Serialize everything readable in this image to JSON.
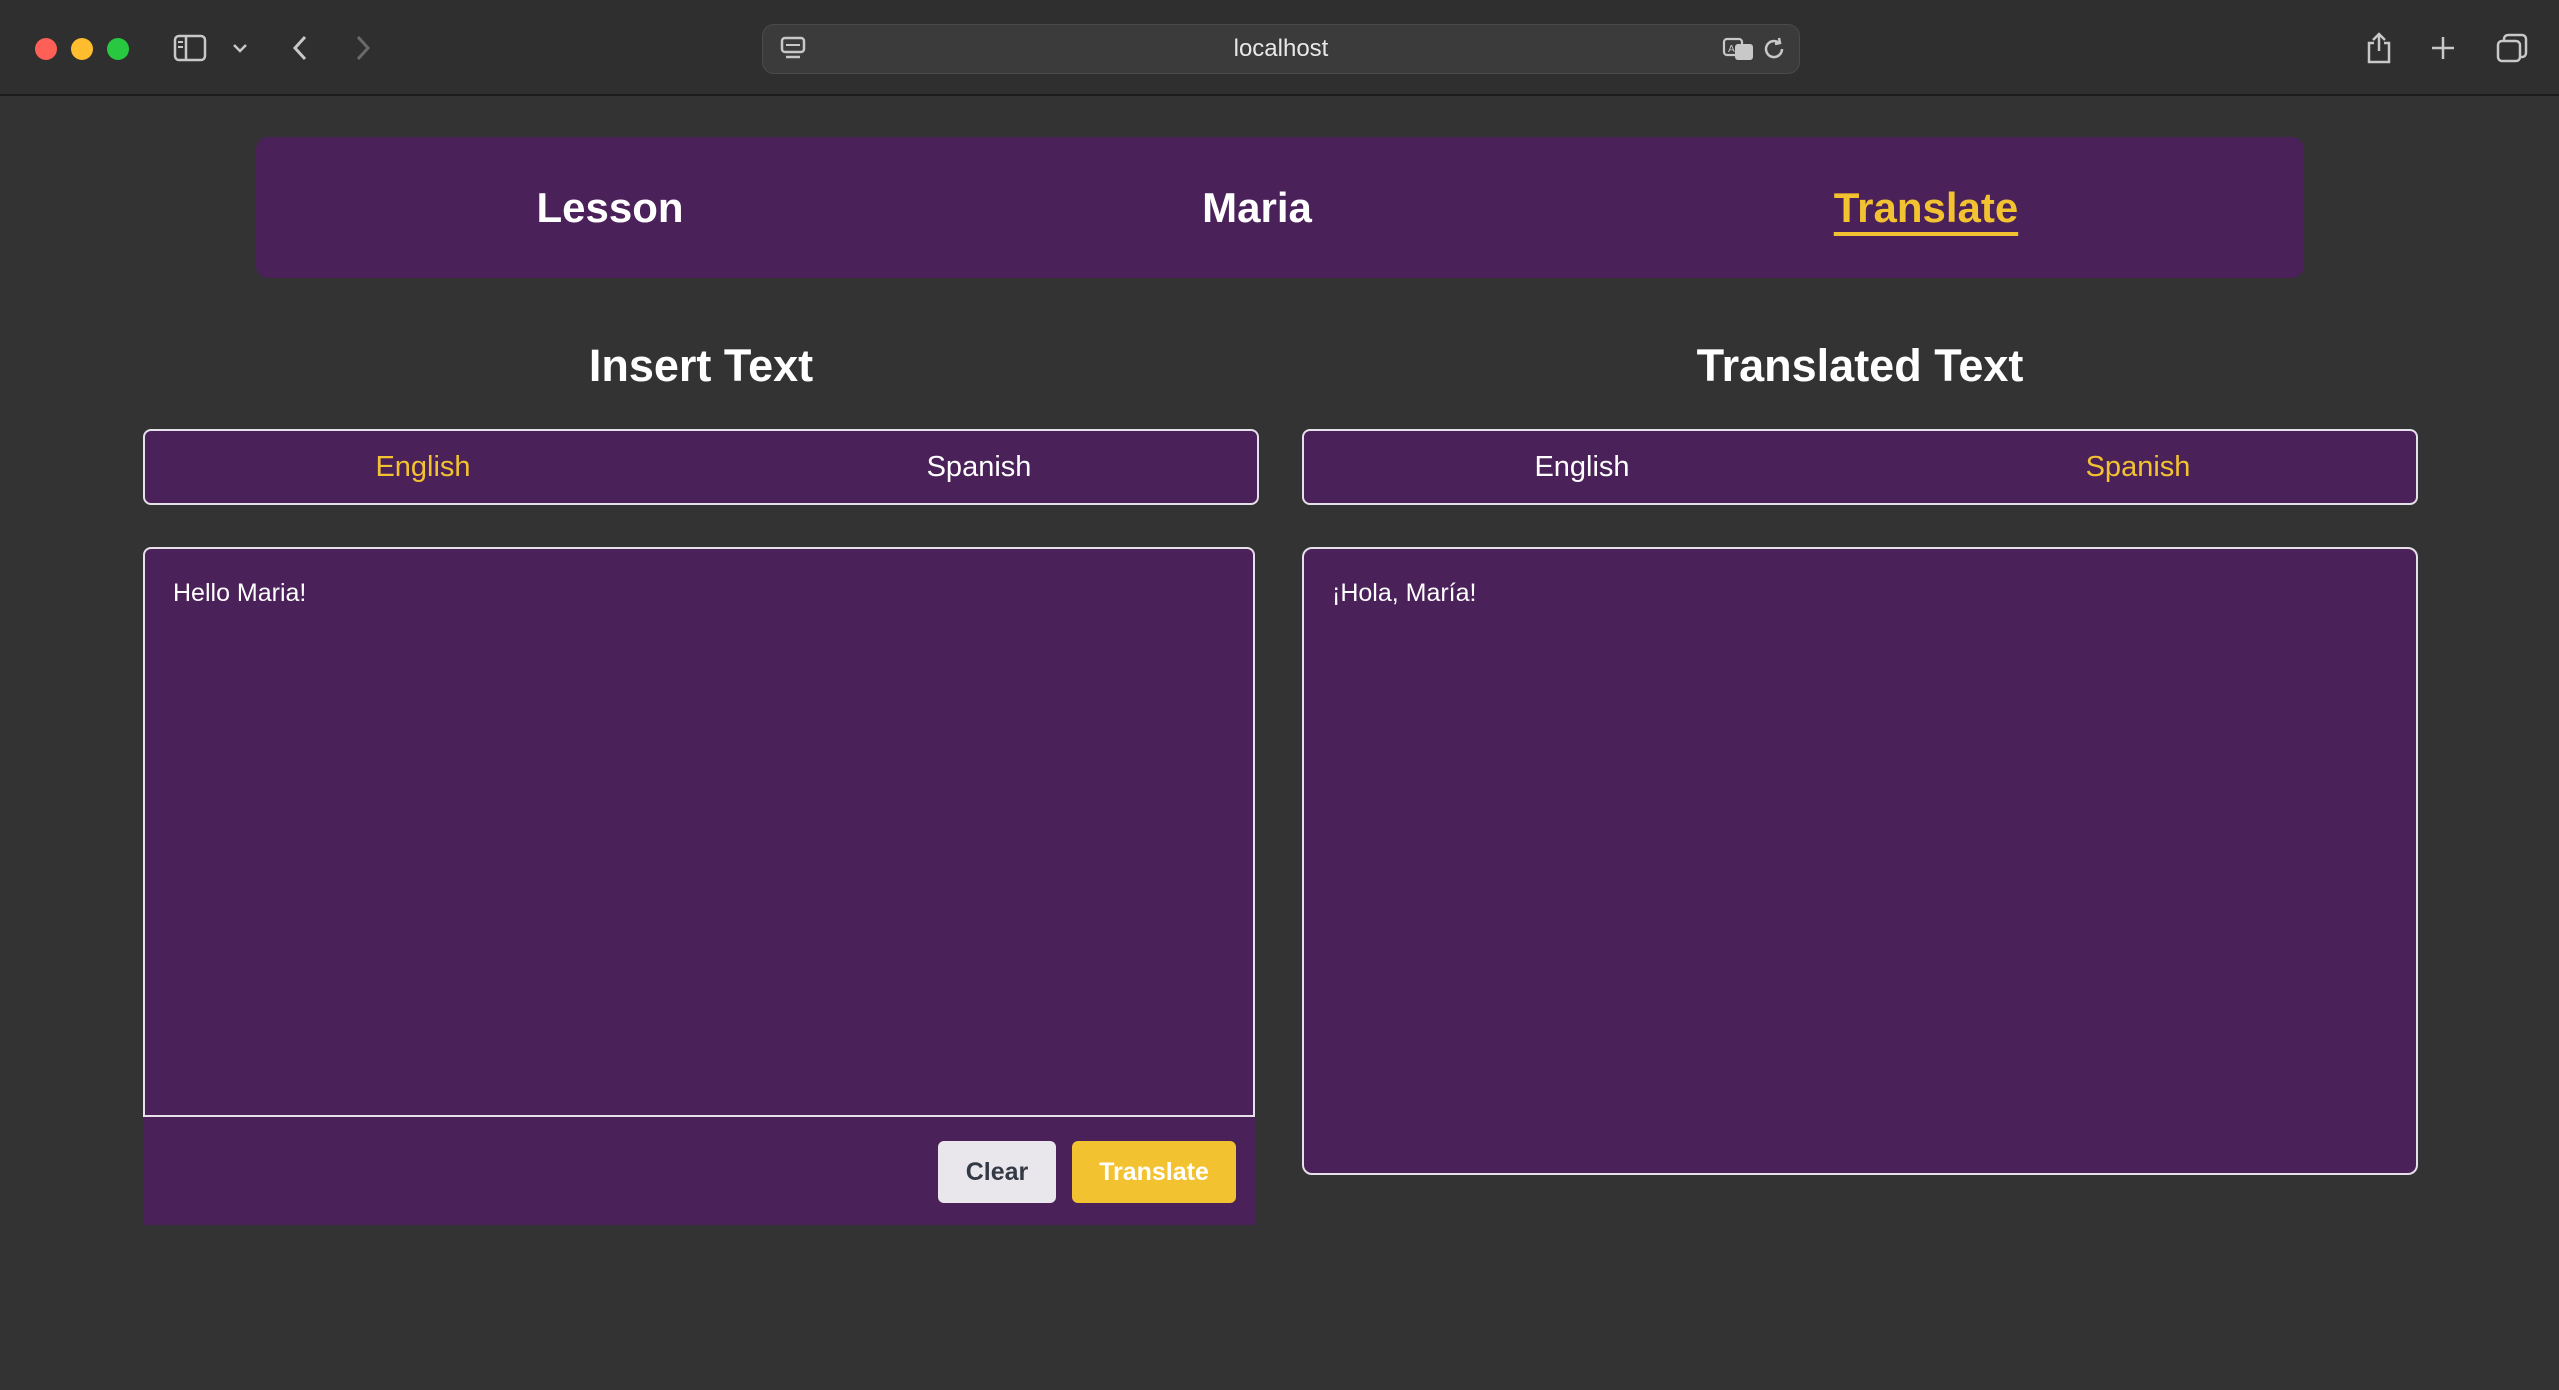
{
  "browser": {
    "address": "localhost"
  },
  "nav": {
    "items": [
      {
        "label": "Lesson"
      },
      {
        "label": "Maria"
      },
      {
        "label": "Translate"
      }
    ],
    "active": "Translate"
  },
  "input_panel": {
    "heading": "Insert Text",
    "languages": [
      "English",
      "Spanish"
    ],
    "selected_language": "English",
    "text": "Hello Maria!",
    "clear_label": "Clear",
    "translate_label": "Translate"
  },
  "output_panel": {
    "heading": "Translated Text",
    "languages": [
      "English",
      "Spanish"
    ],
    "selected_language": "Spanish",
    "text": "¡Hola, María!"
  },
  "colors": {
    "accent": "#f2c230",
    "panel": "#4a2159",
    "background": "#333333"
  }
}
